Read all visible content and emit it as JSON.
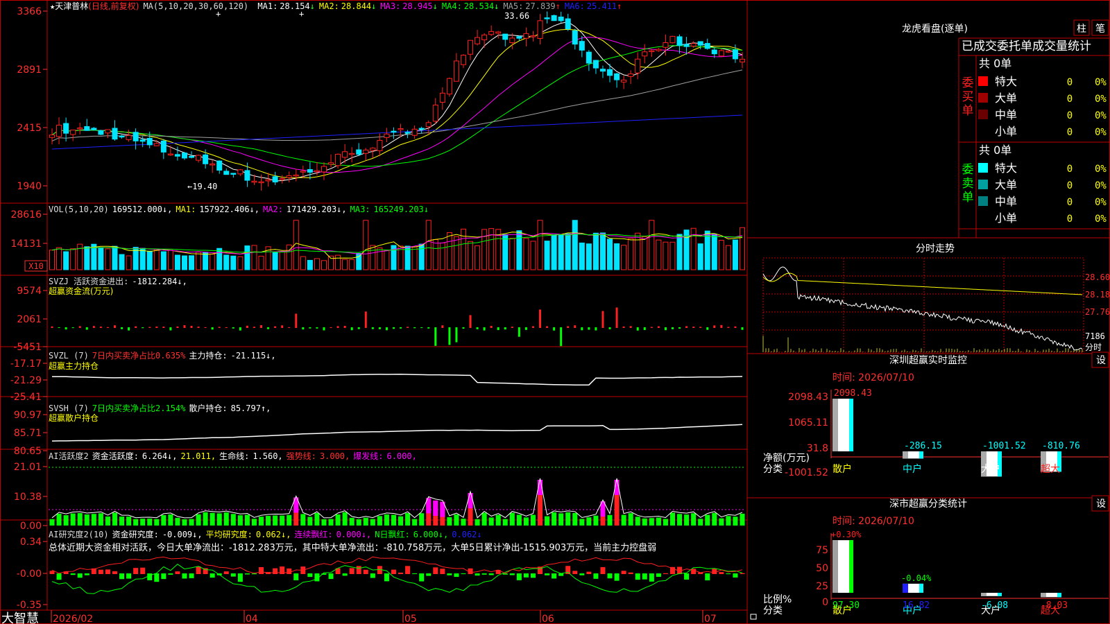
{
  "colors": {
    "up": "#ff2020",
    "down": "#00e5ff",
    "frame": "#c00000",
    "axis": "#ff3030",
    "yellow": "#ffff00",
    "magenta": "#ff00ff",
    "green": "#00ff00",
    "white": "#ffffff",
    "blue": "#2020ff",
    "cyan": "#00ffff",
    "olive": "#c8c800",
    "bright_green": "#33ff33",
    "gray": "#a0a0a0"
  },
  "top_right_buttons": [
    "柱",
    "笔"
  ],
  "main_panel": {
    "indicator_prefix": "★",
    "stock": "天津普林",
    "period": "(日线,前复权)",
    "params": "MA(5,10,20,30,60,120)",
    "ma_values": [
      {
        "label": "MA1:",
        "value": "28.154",
        "arrow": "↓",
        "color": "#ffffff"
      },
      {
        "label": "MA2:",
        "value": "28.844",
        "arrow": "↓",
        "color": "#ffff00"
      },
      {
        "label": "MA3:",
        "value": "28.945",
        "arrow": "↓",
        "color": "#ff00ff"
      },
      {
        "label": "MA4:",
        "value": "28.534",
        "arrow": "↓",
        "color": "#00ff00"
      },
      {
        "label": "MA5:",
        "value": "27.839",
        "arrow": "↑",
        "color": "#a0a0a0"
      },
      {
        "label": "MA6:",
        "value": "25.411",
        "arrow": "↑",
        "color": "#2020ff"
      }
    ],
    "y_ticks": [
      "3366",
      "2891",
      "2415",
      "1940"
    ],
    "high_label": "33.66",
    "low_label": "←19.40"
  },
  "vol_panel": {
    "header_parts": [
      {
        "text": "VOL(5,10,20)",
        "color": "#dddddd"
      },
      {
        "text": "169512.000↓,",
        "color": "#ffffff"
      },
      {
        "text": "MA1:",
        "color": "#ffff00"
      },
      {
        "text": "157922.406↓,",
        "color": "#ffffff"
      },
      {
        "text": "MA2:",
        "color": "#ff00ff"
      },
      {
        "text": "171429.203↓,",
        "color": "#ffffff"
      },
      {
        "text": "MA3:",
        "color": "#00ff00"
      },
      {
        "text": "165249.203↓",
        "color": "#00ff00"
      }
    ],
    "y_ticks": [
      "28616",
      "14131"
    ],
    "unit": "X10"
  },
  "svzj_panel": {
    "line1": [
      {
        "text": "SVZJ  活跃资金进出:",
        "color": "#dddddd"
      },
      {
        "text": "-1812.284↓,",
        "color": "#ffffff"
      }
    ],
    "line2": "超赢资金流(万元)",
    "y_ticks": [
      "9574",
      "2061",
      "-5451"
    ]
  },
  "svzl_panel": {
    "line1": [
      {
        "text": "SVZL (7)",
        "color": "#dddddd"
      },
      {
        "text": "7日内买卖净占比0.635%",
        "color": "#ff3030"
      },
      {
        "text": "主力持仓:",
        "color": "#ffffff"
      },
      {
        "text": "-21.115↓,",
        "color": "#ffffff"
      }
    ],
    "line2": "超赢主力持仓",
    "y_ticks": [
      "-17.17",
      "-21.29",
      "-25.41"
    ]
  },
  "svsh_panel": {
    "line1": [
      {
        "text": "SVSH (7)",
        "color": "#dddddd"
      },
      {
        "text": "7日内买卖净占比2.154%",
        "color": "#00ff00"
      },
      {
        "text": "散户持仓:",
        "color": "#ffffff"
      },
      {
        "text": "85.797↑,",
        "color": "#ffffff"
      }
    ],
    "line2": "超赢散户持仓",
    "y_ticks": [
      "90.97",
      "85.71",
      "80.65"
    ]
  },
  "ai_activity_panel": {
    "line1": [
      {
        "text": "AI活跃度2",
        "color": "#dddddd"
      },
      {
        "text": "资金活跃度:",
        "color": "#ffffff"
      },
      {
        "text": "6.264↓,",
        "color": "#ffffff"
      },
      {
        "text": "21.011,",
        "color": "#ffff00"
      },
      {
        "text": "生命线:",
        "color": "#ffffff"
      },
      {
        "text": "1.560,",
        "color": "#ffffff"
      },
      {
        "text": "强势线:",
        "color": "#ff3030"
      },
      {
        "text": "3.000,",
        "color": "#ff3030"
      },
      {
        "text": "爆发线:",
        "color": "#ff00ff"
      },
      {
        "text": "6.000,",
        "color": "#ff00ff"
      }
    ],
    "y_ticks": [
      "21.01",
      "10.38",
      "0.00"
    ]
  },
  "ai_research_panel": {
    "line1": [
      {
        "text": "AI研究度2(10)",
        "color": "#dddddd"
      },
      {
        "text": "资金研究度:",
        "color": "#ffffff"
      },
      {
        "text": "-0.009↓,",
        "color": "#ffffff"
      },
      {
        "text": "平均研究度:",
        "color": "#ffff00"
      },
      {
        "text": "0.062↓,",
        "color": "#ffff00"
      },
      {
        "text": "连续飘红:",
        "color": "#ff00ff"
      },
      {
        "text": "0.000↓,",
        "color": "#ff00ff"
      },
      {
        "text": "N日飘红:",
        "color": "#00ff00"
      },
      {
        "text": "6.000↓,",
        "color": "#00ff00"
      },
      {
        "text": "0.062↓",
        "color": "#2020ff"
      }
    ],
    "summary": "总体近期大资金相对活跃，今日大单净流出：-1812.283万元，其中特大单净流出：-810.758万元，大单5日累计净出-1515.903万元，当前主力控盘弱",
    "y_ticks": [
      "0.34",
      "-0.00",
      "-0.35"
    ]
  },
  "x_axis": {
    "labels": [
      "2026/02",
      "04",
      "05",
      "06",
      "07"
    ],
    "brand": "大智慧"
  },
  "dragon_tiger": {
    "title": "龙虎看盘(逐单)",
    "heading": "已成交委托单成交量统计",
    "buy": {
      "label": "委买单",
      "total": "共 0单",
      "rows": [
        {
          "name": "特大",
          "count": "0",
          "pct": "0%",
          "swatch": "#ff0000"
        },
        {
          "name": "大单",
          "count": "0",
          "pct": "0%",
          "swatch": "#a00000"
        },
        {
          "name": "中单",
          "count": "0",
          "pct": "0%",
          "swatch": "#6a0000"
        },
        {
          "name": "小单",
          "count": "0",
          "pct": "0%",
          "swatch": ""
        }
      ]
    },
    "sell": {
      "label": "委卖单",
      "total": "共 0单",
      "rows": [
        {
          "name": "特大",
          "count": "0",
          "pct": "0%",
          "swatch": "#00ffff"
        },
        {
          "name": "大单",
          "count": "0",
          "pct": "0%",
          "swatch": "#00a0a0"
        },
        {
          "name": "中单",
          "count": "0",
          "pct": "0%",
          "swatch": "#008080"
        },
        {
          "name": "小单",
          "count": "0",
          "pct": "0%",
          "swatch": ""
        }
      ]
    }
  },
  "intraday": {
    "title": "分时走势",
    "y_ticks": [
      "28.60",
      "28.18",
      "27.76",
      "7186"
    ],
    "footer": "分时"
  },
  "realtime_monitor": {
    "title": "深圳超赢实时监控",
    "settings": "设",
    "time": "时间: 2026/07/10",
    "y_ticks": [
      "2098.43",
      "1065.11",
      "31.8",
      "-1001.52"
    ],
    "y_axis_label": "净额(万元)",
    "x_axis_label": "分类"
  },
  "classify_stats": {
    "title": "深市超赢分类统计",
    "settings": "设",
    "time": "时间: 2026/07/10",
    "y_ticks": [
      "75",
      "50",
      "25",
      "0"
    ],
    "y_axis_label": "比例%",
    "x_axis_label": "分类"
  },
  "chart_data": [
    {
      "type": "bar",
      "title": "深圳超赢实时监控",
      "ylabel": "净额(万元)",
      "xlabel": "分类",
      "categories": [
        "散户",
        "中户",
        "大户",
        "超大"
      ],
      "values": [
        2098.43,
        -286.15,
        -1001.52,
        -810.76
      ],
      "ylim": [
        -1001.52,
        2098.43
      ]
    },
    {
      "type": "bar",
      "title": "深市超赢分类统计",
      "ylabel": "比例%",
      "xlabel": "分类",
      "categories": [
        "散户",
        "中户",
        "大户",
        "超大"
      ],
      "values": [
        97.3,
        16.82,
        -6.08,
        -8.03
      ],
      "labels_top": [
        "+0.30%",
        "-0.04%",
        "",
        ""
      ],
      "ylim": [
        0,
        100
      ]
    }
  ]
}
